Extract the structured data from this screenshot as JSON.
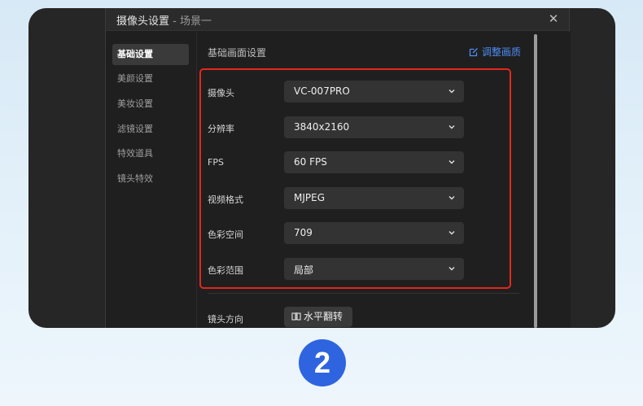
{
  "window": {
    "title": "摄像头设置",
    "title_sep": " - ",
    "subtitle": "场景一"
  },
  "sidebar": {
    "items": [
      {
        "label": "基础设置",
        "active": true
      },
      {
        "label": "美颜设置",
        "active": false
      },
      {
        "label": "美妆设置",
        "active": false
      },
      {
        "label": "滤镜设置",
        "active": false
      },
      {
        "label": "特效道具",
        "active": false
      },
      {
        "label": "镜头特效",
        "active": false
      }
    ]
  },
  "main": {
    "section_title": "基础画面设置",
    "adjust_link": "调整画质",
    "rows": [
      {
        "label": "摄像头",
        "value": "VC-007PRO"
      },
      {
        "label": "分辨率",
        "value": "3840x2160"
      },
      {
        "label": "FPS",
        "value": "60 FPS"
      },
      {
        "label": "视频格式",
        "value": "MJPEG"
      },
      {
        "label": "色彩空间",
        "value": "709"
      },
      {
        "label": "色彩范围",
        "value": "局部"
      }
    ],
    "lens_direction_label": "镜头方向",
    "flip_button": "水平翻转"
  },
  "step_number": "2",
  "colors": {
    "accent": "#4d8df5",
    "highlight": "#e3271e",
    "badge": "#2f64e0",
    "panel": "#1f1f1f"
  },
  "icons": {
    "close": "close-icon",
    "edit": "edit-icon",
    "chevron": "chevron-down-icon",
    "mirror": "mirror-flip-icon"
  }
}
